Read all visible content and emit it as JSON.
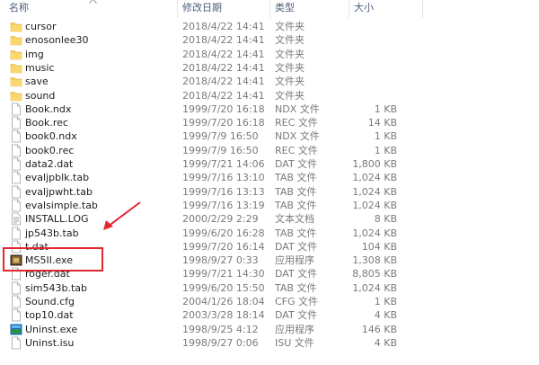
{
  "header": {
    "name": "名称",
    "date": "修改日期",
    "type": "类型",
    "size": "大小"
  },
  "files": [
    {
      "name": "cursor",
      "date": "2018/4/22 14:41",
      "type": "文件夹",
      "size": "",
      "icon": "folder-icon"
    },
    {
      "name": "enosonlee30",
      "date": "2018/4/22 14:41",
      "type": "文件夹",
      "size": "",
      "icon": "folder-icon"
    },
    {
      "name": "img",
      "date": "2018/4/22 14:41",
      "type": "文件夹",
      "size": "",
      "icon": "folder-icon"
    },
    {
      "name": "music",
      "date": "2018/4/22 14:41",
      "type": "文件夹",
      "size": "",
      "icon": "folder-icon"
    },
    {
      "name": "save",
      "date": "2018/4/22 14:41",
      "type": "文件夹",
      "size": "",
      "icon": "folder-icon"
    },
    {
      "name": "sound",
      "date": "2018/4/22 14:41",
      "type": "文件夹",
      "size": "",
      "icon": "folder-icon"
    },
    {
      "name": "Book.ndx",
      "date": "1999/7/20 16:18",
      "type": "NDX 文件",
      "size": "1 KB",
      "icon": "file-icon"
    },
    {
      "name": "Book.rec",
      "date": "1999/7/20 16:18",
      "type": "REC 文件",
      "size": "14 KB",
      "icon": "file-icon"
    },
    {
      "name": "book0.ndx",
      "date": "1999/7/9 16:50",
      "type": "NDX 文件",
      "size": "1 KB",
      "icon": "file-icon"
    },
    {
      "name": "book0.rec",
      "date": "1999/7/9 16:50",
      "type": "REC 文件",
      "size": "1 KB",
      "icon": "file-icon"
    },
    {
      "name": "data2.dat",
      "date": "1999/7/21 14:06",
      "type": "DAT 文件",
      "size": "1,800 KB",
      "icon": "file-icon"
    },
    {
      "name": "evaljpblk.tab",
      "date": "1999/7/16 13:10",
      "type": "TAB 文件",
      "size": "1,024 KB",
      "icon": "file-icon"
    },
    {
      "name": "evaljpwht.tab",
      "date": "1999/7/16 13:13",
      "type": "TAB 文件",
      "size": "1,024 KB",
      "icon": "file-icon"
    },
    {
      "name": "evalsimple.tab",
      "date": "1999/7/16 13:19",
      "type": "TAB 文件",
      "size": "1,024 KB",
      "icon": "file-icon"
    },
    {
      "name": "INSTALL.LOG",
      "date": "2000/2/29 2:29",
      "type": "文本文档",
      "size": "8 KB",
      "icon": "text-file-icon"
    },
    {
      "name": "jp543b.tab",
      "date": "1999/6/20 16:28",
      "type": "TAB 文件",
      "size": "1,024 KB",
      "icon": "file-icon"
    },
    {
      "name": "t.dat",
      "date": "1999/7/20 16:14",
      "type": "DAT 文件",
      "size": "104 KB",
      "icon": "file-icon"
    },
    {
      "name": "MS5II.exe",
      "date": "1998/9/27 0:33",
      "type": "应用程序",
      "size": "1,308 KB",
      "icon": "game-exe-icon"
    },
    {
      "name": "roger.dat",
      "date": "1999/7/21 14:30",
      "type": "DAT 文件",
      "size": "8,805 KB",
      "icon": "file-icon"
    },
    {
      "name": "sim543b.tab",
      "date": "1999/6/20 15:50",
      "type": "TAB 文件",
      "size": "1,024 KB",
      "icon": "file-icon"
    },
    {
      "name": "Sound.cfg",
      "date": "2004/1/26 18:04",
      "type": "CFG 文件",
      "size": "1 KB",
      "icon": "file-icon"
    },
    {
      "name": "top10.dat",
      "date": "2003/3/28 18:14",
      "type": "DAT 文件",
      "size": "4 KB",
      "icon": "file-icon"
    },
    {
      "name": "Uninst.exe",
      "date": "1998/9/25 4:12",
      "type": "应用程序",
      "size": "146 KB",
      "icon": "uninstall-exe-icon"
    },
    {
      "name": "Uninst.isu",
      "date": "1998/9/27 0:06",
      "type": "ISU 文件",
      "size": "4 KB",
      "icon": "file-icon"
    }
  ],
  "annotation": {
    "highlight_color": "#e1262d",
    "highlighted_file": "MS5II.exe"
  },
  "colors": {
    "folder": "#f5c85a",
    "header_text": "#4c607a",
    "meta_text": "#7a7a7a"
  }
}
